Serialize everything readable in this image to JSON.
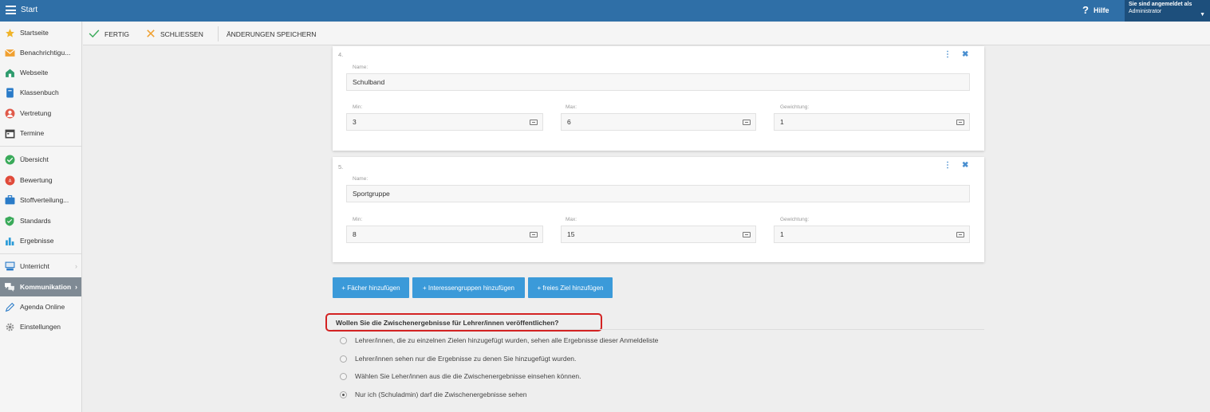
{
  "topbar": {
    "title": "Start",
    "help_label": "Hilfe",
    "user_line1": "Sie sind angemeldet als",
    "user_line2": "Administrator"
  },
  "sidebar": {
    "items": [
      {
        "label": "Startseite",
        "icon": "star-icon"
      },
      {
        "label": "Benachrichtigu...",
        "icon": "envelope-icon"
      },
      {
        "label": "Webseite",
        "icon": "house-icon"
      },
      {
        "label": "Klassenbuch",
        "icon": "book-icon"
      },
      {
        "label": "Vertretung",
        "icon": "person-icon"
      },
      {
        "label": "Termine",
        "icon": "calendar-icon"
      },
      {
        "label": "Übersicht",
        "icon": "check-circle-icon"
      },
      {
        "label": "Bewertung",
        "icon": "grade-icon"
      },
      {
        "label": "Stoffverteilung...",
        "icon": "briefcase-icon"
      },
      {
        "label": "Standards",
        "icon": "shield-check-icon"
      },
      {
        "label": "Ergebnisse",
        "icon": "bar-chart-icon"
      },
      {
        "label": "Unterricht",
        "icon": "classroom-icon"
      },
      {
        "label": "Kommunikation",
        "icon": "chat-bubbles-icon"
      },
      {
        "label": "Agenda Online",
        "icon": "pen-icon"
      },
      {
        "label": "Einstellungen",
        "icon": "gear-icon"
      }
    ]
  },
  "toolbar": {
    "done_label": "FERTIG",
    "close_label": "SCHLIESSEN",
    "save_label": "ÄNDERUNGEN SPEICHERN"
  },
  "cards": [
    {
      "number": "4.",
      "name_label": "Name:",
      "name_value": "Schulband",
      "min_label": "Min:",
      "min_value": "3",
      "max_label": "Max:",
      "max_value": "6",
      "weight_label": "Gewichtung:",
      "weight_value": "1"
    },
    {
      "number": "5.",
      "name_label": "Name:",
      "name_value": "Sportgruppe",
      "min_label": "Min:",
      "min_value": "8",
      "max_label": "Max:",
      "max_value": "15",
      "weight_label": "Gewichtung:",
      "weight_value": "1"
    }
  ],
  "add_buttons": {
    "subjects": "+ Fächer hinzufügen",
    "interest_groups": "+ Interessengruppen hinzufügen",
    "free_goal": "+ freies Ziel hinzufügen"
  },
  "question": "Wollen Sie die Zwischenergebnisse für Lehrer/innen veröffentlichen?",
  "options": [
    {
      "label": "Lehrer/innen, die zu einzelnen Zielen hinzugefügt wurden, sehen alle Ergebnisse dieser Anmeldeliste",
      "checked": false
    },
    {
      "label": "Lehrer/innen sehen nur die Ergebnisse zu denen Sie hinzugefügt wurden.",
      "checked": false
    },
    {
      "label": "Wählen Sie Leher/innen aus die die Zwischenergebnisse einsehen können.",
      "checked": false
    },
    {
      "label": "Nur ich (Schuladmin) darf die Zwischenergebnisse sehen",
      "checked": true
    }
  ],
  "colors": {
    "topbar": "#2f6fa7",
    "accent_button": "#3b9ad9",
    "highlight_border": "#d32222"
  }
}
